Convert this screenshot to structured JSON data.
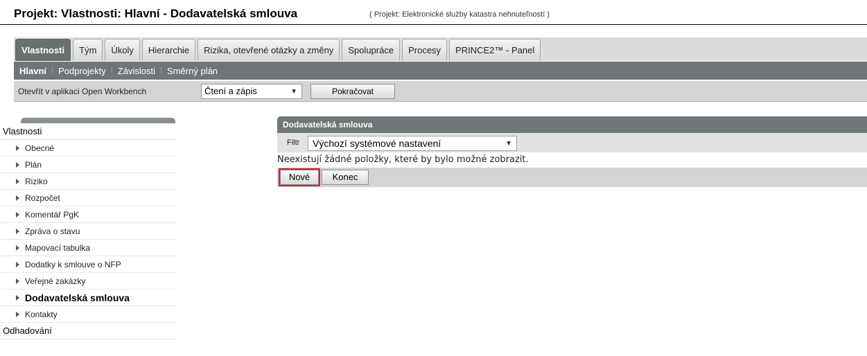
{
  "page": {
    "title": "Projekt: Vlastnosti: Hlavní - Dodavatelská smlouva",
    "subtitle": "( Projekt: Elektronické služby katastra nehnuteľností )"
  },
  "tabs": [
    {
      "label": "Vlastnosti",
      "active": true
    },
    {
      "label": "Tým",
      "active": false
    },
    {
      "label": "Úkoly",
      "active": false
    },
    {
      "label": "Hierarchie",
      "active": false
    },
    {
      "label": "Rizika, otevřené otázky a změny",
      "active": false
    },
    {
      "label": "Spolupráce",
      "active": false
    },
    {
      "label": "Procesy",
      "active": false
    },
    {
      "label": "PRINCE2™ - Panel",
      "active": false
    }
  ],
  "subnav": [
    {
      "label": "Hlavní",
      "active": true
    },
    {
      "label": "Podprojekty",
      "active": false
    },
    {
      "label": "Závislosti",
      "active": false
    },
    {
      "label": "Směrný plán",
      "active": false
    }
  ],
  "toolbar": {
    "open_label": "Otevřít v aplikaci Open Workbench",
    "mode_value": "Čtení a zápis",
    "continue_label": "Pokračovat"
  },
  "sidebar": {
    "section_label": "Vlastnosti",
    "items": [
      {
        "label": "Obecné",
        "active": false
      },
      {
        "label": "Plán",
        "active": false
      },
      {
        "label": "Riziko",
        "active": false
      },
      {
        "label": "Rozpočet",
        "active": false
      },
      {
        "label": "Komentář PgK",
        "active": false
      },
      {
        "label": "Zpráva o stavu",
        "active": false
      },
      {
        "label": "Mapovací tabulka",
        "active": false
      },
      {
        "label": "Dodatky k smlouve o NFP",
        "active": false
      },
      {
        "label": "Veřejné zakázky",
        "active": false
      },
      {
        "label": "Dodavatelská smlouva",
        "active": true
      },
      {
        "label": "Kontakty",
        "active": false
      }
    ],
    "next_section_label": "Odhadování"
  },
  "panel": {
    "title": "Dodavatelská smlouva",
    "filter_label": "Filtr",
    "filter_value": "Výchozí systémové nastavení",
    "empty_message": "Neexistují žádné položky, které by bylo možné zobrazit.",
    "new_label": "Nové",
    "close_label": "Konec"
  },
  "colors": {
    "active_tab": "#6a6f70",
    "subnav_bg": "#707677",
    "highlight_outline": "#e8141c"
  }
}
